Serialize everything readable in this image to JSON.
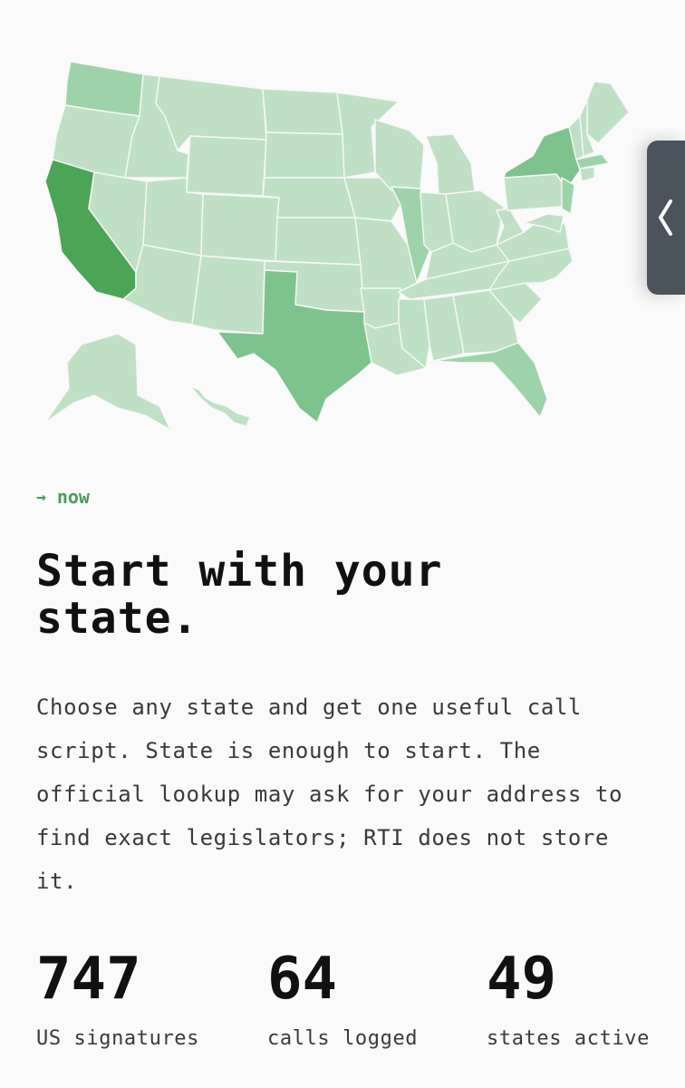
{
  "map": {
    "states": [
      {
        "id": "WA",
        "level": 1
      },
      {
        "id": "OR",
        "level": 0
      },
      {
        "id": "CA",
        "level": 3
      },
      {
        "id": "ID",
        "level": 0
      },
      {
        "id": "NV",
        "level": 0
      },
      {
        "id": "MT",
        "level": 0
      },
      {
        "id": "WY",
        "level": 0
      },
      {
        "id": "UT",
        "level": 0
      },
      {
        "id": "AZ",
        "level": 0
      },
      {
        "id": "CO",
        "level": 0
      },
      {
        "id": "NM",
        "level": 0
      },
      {
        "id": "ND",
        "level": 0
      },
      {
        "id": "SD",
        "level": 0
      },
      {
        "id": "NE",
        "level": 0
      },
      {
        "id": "KS",
        "level": 0
      },
      {
        "id": "OK",
        "level": 0
      },
      {
        "id": "TX",
        "level": 2
      },
      {
        "id": "MN",
        "level": 0
      },
      {
        "id": "IA",
        "level": 0
      },
      {
        "id": "MO",
        "level": 0
      },
      {
        "id": "AR",
        "level": 0
      },
      {
        "id": "LA",
        "level": 0
      },
      {
        "id": "WI",
        "level": 0
      },
      {
        "id": "IL",
        "level": 1
      },
      {
        "id": "MI",
        "level": 0
      },
      {
        "id": "IN",
        "level": 0
      },
      {
        "id": "OH",
        "level": 0
      },
      {
        "id": "KY",
        "level": 0
      },
      {
        "id": "TN",
        "level": 0
      },
      {
        "id": "MS",
        "level": 0
      },
      {
        "id": "AL",
        "level": 0
      },
      {
        "id": "GA",
        "level": 0
      },
      {
        "id": "FL",
        "level": 1
      },
      {
        "id": "SC",
        "level": 0
      },
      {
        "id": "NC",
        "level": 0
      },
      {
        "id": "VA",
        "level": 0
      },
      {
        "id": "WV",
        "level": 0
      },
      {
        "id": "PA",
        "level": 0
      },
      {
        "id": "NY",
        "level": 2
      },
      {
        "id": "NJ",
        "level": 1
      },
      {
        "id": "ME",
        "level": 0
      },
      {
        "id": "VT",
        "level": 0
      },
      {
        "id": "NH",
        "level": 0
      },
      {
        "id": "MA",
        "level": 1
      },
      {
        "id": "CT",
        "level": 0
      },
      {
        "id": "MD",
        "level": 0
      },
      {
        "id": "AK",
        "level": 0
      },
      {
        "id": "HI",
        "level": 0
      }
    ],
    "colors": [
      "#bfe0c5",
      "#9ed3a9",
      "#7ec38d",
      "#4ca457"
    ]
  },
  "side_tab": {
    "icon": "chevron-left-icon"
  },
  "kicker": {
    "arrow": "→",
    "label": "now"
  },
  "headline": "Start with your state.",
  "body": "Choose any state and get one useful call script. State is enough to start. The official lookup may ask for your address to find exact legislators; RTI does not store it.",
  "stats": [
    {
      "value": "747",
      "label": "US signatures"
    },
    {
      "value": "64",
      "label": "calls logged"
    },
    {
      "value": "49",
      "label": "states active"
    }
  ]
}
